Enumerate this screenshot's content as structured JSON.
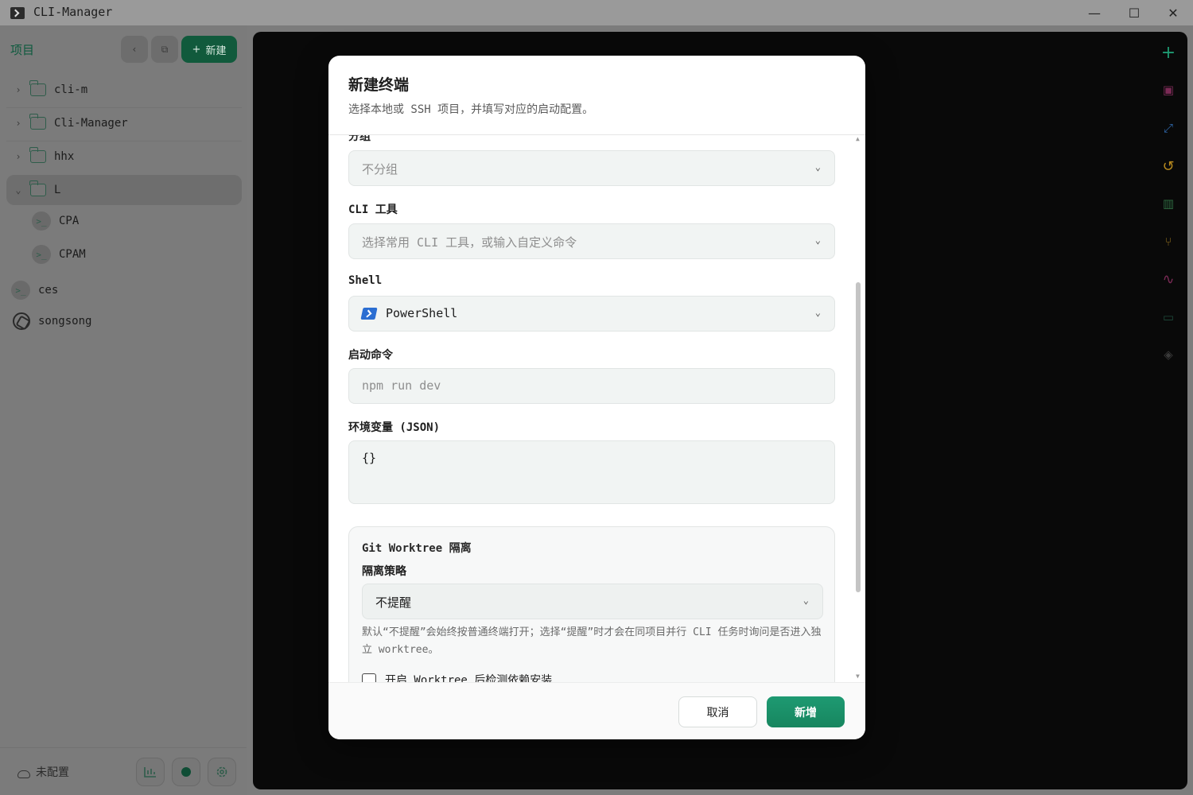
{
  "window": {
    "title": "CLI-Manager",
    "minimize": "—",
    "maximize": "☐",
    "close": "✕"
  },
  "sidebar": {
    "title": "项目",
    "back_button": "‹",
    "folder_button": "⧉",
    "new_button": "新建",
    "new_button_icon": "+",
    "items": [
      {
        "label": "cli-m",
        "type": "folder",
        "expanded": false,
        "chevron": "›"
      },
      {
        "label": "Cli-Manager",
        "type": "folder",
        "expanded": false,
        "chevron": "›"
      },
      {
        "label": "hhx",
        "type": "folder",
        "expanded": false,
        "chevron": "›"
      },
      {
        "label": "L",
        "type": "folder",
        "expanded": true,
        "chevron": "⌄"
      },
      {
        "label": "CPA",
        "type": "terminal",
        "icon": ">_"
      },
      {
        "label": "CPAM",
        "type": "terminal",
        "icon": ">_"
      },
      {
        "label": "ces",
        "type": "terminal",
        "icon": ">_"
      },
      {
        "label": "songsong",
        "type": "openai"
      }
    ],
    "footer": {
      "status": "未配置",
      "stats_icon": "chart-icon",
      "record_icon": "record-icon",
      "settings_icon": "gear-icon"
    }
  },
  "right_rail": {
    "icons": [
      {
        "name": "plus-icon",
        "glyph": "+",
        "color": "#1e9a72"
      },
      {
        "name": "terminal-icon",
        "glyph": "▣",
        "color": "#7a2a55"
      },
      {
        "name": "expand-icon",
        "glyph": "⤢",
        "color": "#2f66a8"
      },
      {
        "name": "history-icon",
        "glyph": "↺",
        "color": "#b88a1e"
      },
      {
        "name": "chart-icon",
        "glyph": "▥",
        "color": "#2e6a40"
      },
      {
        "name": "git-branch-icon",
        "glyph": "⑂",
        "color": "#8a6a1e"
      },
      {
        "name": "activity-icon",
        "glyph": "∿",
        "color": "#7a2a55"
      },
      {
        "name": "folder-icon",
        "glyph": "▭",
        "color": "#1e4a3a"
      },
      {
        "name": "layers-icon",
        "glyph": "◈",
        "color": "#3a3a3a"
      }
    ]
  },
  "dialog": {
    "title": "新建终端",
    "subtitle": "选择本地或 SSH 项目，并填写对应的启动配置。",
    "group": {
      "label": "分组",
      "value": "不分组"
    },
    "cli_tool": {
      "label": "CLI 工具",
      "placeholder": "选择常用 CLI 工具，或输入自定义命令"
    },
    "shell": {
      "label": "Shell",
      "value": "PowerShell"
    },
    "start_command": {
      "label": "启动命令",
      "placeholder": "npm run dev"
    },
    "env": {
      "label": "环境变量 (JSON)",
      "value": "{}"
    },
    "worktree": {
      "title": "Git Worktree 隔离",
      "strategy_label": "隔离策略",
      "strategy_value": "不提醒",
      "hint": "默认“不提醒”会始终按普通终端打开；选择“提醒”时才会在同项目并行 CLI 任务时询问是否进入独立 worktree。",
      "checkbox_label": "开启 Worktree 后检测依赖安装"
    },
    "cancel_button": "取消",
    "submit_button": "新增"
  },
  "colors": {
    "accent": "#1a8f69",
    "sidebar_title": "#0d5a3e"
  }
}
